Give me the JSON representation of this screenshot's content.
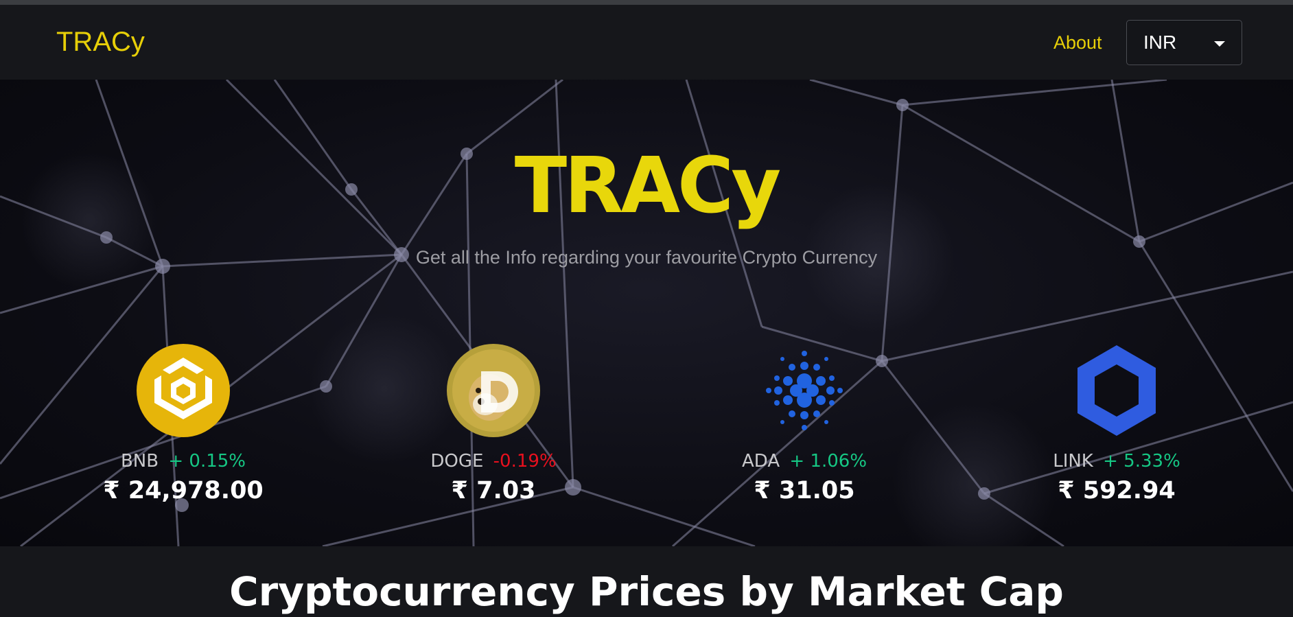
{
  "navbar": {
    "brand": "TRACy",
    "about_label": "About",
    "currency_select": {
      "value": "INR"
    }
  },
  "hero": {
    "title": "TRACy",
    "subtitle": "Get all the Info regarding your favourite Crypto Currency"
  },
  "carousel": {
    "coins": [
      {
        "symbol": "BNB",
        "change": "+ 0.15%",
        "change_direction": "up",
        "price": "₹ 24,978.00",
        "icon": "bnb-logo-icon",
        "color": "#e6b50a"
      },
      {
        "symbol": "DOGE",
        "change": "-0.19%",
        "change_direction": "down",
        "price": "₹ 7.03",
        "icon": "doge-logo-icon",
        "color": "#b6a03a"
      },
      {
        "symbol": "ADA",
        "change": "+ 1.06%",
        "change_direction": "up",
        "price": "₹ 31.05",
        "icon": "ada-logo-icon",
        "color": "#2163e0"
      },
      {
        "symbol": "LINK",
        "change": "+ 5.33%",
        "change_direction": "up",
        "price": "₹ 592.94",
        "icon": "link-logo-icon",
        "color": "#2f5ce0"
      }
    ]
  },
  "section": {
    "title": "Cryptocurrency Prices by Market Cap"
  },
  "colors": {
    "accent": "#e8d70b",
    "positive": "#16c784",
    "negative": "#e8101e",
    "background": "#16171b"
  }
}
